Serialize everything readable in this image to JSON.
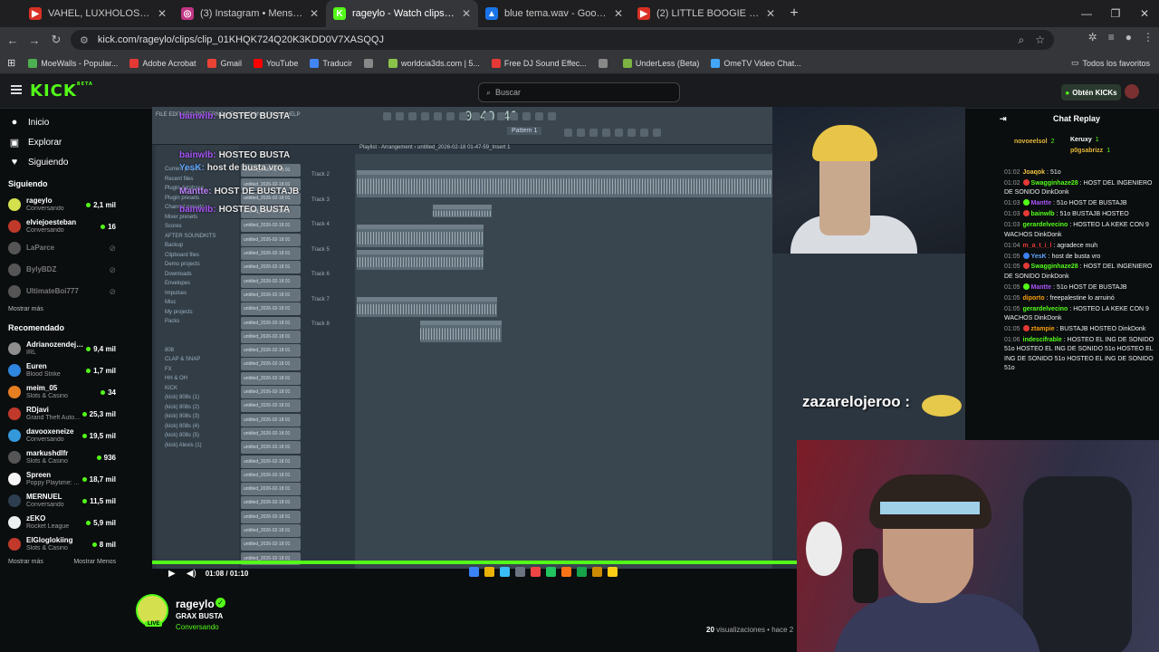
{
  "browser": {
    "tabs": [
      {
        "title": "VAHEL, LUXHOLOSNO, LOLO -",
        "fav_color": "#d93025",
        "fav": "▶"
      },
      {
        "title": "(3) Instagram • Mensajes",
        "fav_color": "#c13584",
        "fav": "◎"
      },
      {
        "title": "rageylo - Watch clips on Kick",
        "fav_color": "#53fc18",
        "fav": "K",
        "active": true
      },
      {
        "title": "blue tema.wav - Google Drive",
        "fav_color": "#1a73e8",
        "fav": "▲"
      },
      {
        "title": "(2) LITTLE BOOGIE - PUTISHOR",
        "fav_color": "#d93025",
        "fav": "▶"
      }
    ],
    "url": "kick.com/rageylo/clips/clip_01KHQK724Q20K3KDD0V7XASQQJ",
    "bookmarks": [
      {
        "label": "MoeWalls - Popular...",
        "color": "#4caf50"
      },
      {
        "label": "Adobe Acrobat",
        "color": "#e53935"
      },
      {
        "label": "Gmail",
        "color": "#ea4335"
      },
      {
        "label": "YouTube",
        "color": "#ff0000"
      },
      {
        "label": "Traducir",
        "color": "#4285f4"
      },
      {
        "label": "",
        "color": "#888888"
      },
      {
        "label": "worldcia3ds.com | 5...",
        "color": "#8bc34a"
      },
      {
        "label": "Free DJ Sound Effec...",
        "color": "#e53935"
      },
      {
        "label": "",
        "color": "#888888"
      },
      {
        "label": "UnderLess (Beta)",
        "color": "#7cb342"
      },
      {
        "label": "OmeTV Video Chat...",
        "color": "#42a5f5"
      }
    ],
    "all_bookmarks": "Todos los favoritos"
  },
  "kick": {
    "logo": "KICK",
    "logo_beta": "BETA",
    "search_placeholder": "Buscar",
    "get_kicks": "Obtén KICKs",
    "nav": [
      {
        "label": "Inicio",
        "icon": "●"
      },
      {
        "label": "Explorar",
        "icon": "▣"
      },
      {
        "label": "Siguiendo",
        "icon": "♥"
      }
    ],
    "following_title": "Siguiendo",
    "following": [
      {
        "name": "rageylo",
        "cat": "Conversando",
        "viewers": "2,1 mil",
        "color": "#d5e04e"
      },
      {
        "name": "elviejoesteban",
        "cat": "Conversando",
        "viewers": "16",
        "color": "#c0392b"
      },
      {
        "name": "LaParce",
        "cat": "",
        "viewers": "",
        "color": "#555555",
        "offline": true
      },
      {
        "name": "BylyBDZ",
        "cat": "",
        "viewers": "",
        "color": "#555555",
        "offline": true
      },
      {
        "name": "UltimateBoi777",
        "cat": "",
        "viewers": "",
        "color": "#555555",
        "offline": true
      }
    ],
    "show_more": "Mostrar más",
    "recommended_title": "Recomendado",
    "recommended": [
      {
        "name": "Adrianozendeja...",
        "cat": "IRL",
        "viewers": "9,4 mil",
        "color": "#8e8e8e"
      },
      {
        "name": "Euren",
        "cat": "Blood Strike",
        "viewers": "1,7 mil",
        "color": "#2e86de"
      },
      {
        "name": "meim_05",
        "cat": "Slots & Casino",
        "viewers": "34",
        "color": "#e67e22"
      },
      {
        "name": "RDjavi",
        "cat": "Grand Theft Auto...",
        "viewers": "25,3 mil",
        "color": "#c0392b"
      },
      {
        "name": "davooxeneize",
        "cat": "Conversando",
        "viewers": "19,5 mil",
        "color": "#3498db"
      },
      {
        "name": "markushdlfr",
        "cat": "Slots & Casino",
        "viewers": "936",
        "color": "#555555"
      },
      {
        "name": "Spreen",
        "cat": "Poppy Playtime: ...",
        "viewers": "18,7 mil",
        "color": "#f5f5f5"
      },
      {
        "name": "MERNUEL",
        "cat": "Conversando",
        "viewers": "11,5 mil",
        "color": "#2c3e50"
      },
      {
        "name": "zEKO",
        "cat": "Rocket League",
        "viewers": "5,9 mil",
        "color": "#ecf0f1"
      },
      {
        "name": "ElGloglokiing",
        "cat": "Slots & Casino",
        "viewers": "8 mil",
        "color": "#c0392b"
      }
    ],
    "show_more2": "Mostrar más",
    "show_less": "Mostrar Menos"
  },
  "video": {
    "fl_menu": "FILE EDIT ADD PATTERNS VIEW OPTIONS TOOLS HELP",
    "fl_time": "0:40:41",
    "pattern": "Pattern 1",
    "playlist_title": "Playlist - Arrangement › untitled_2026-02-18 01-47-59_Insert 1",
    "browser_items": [
      "Current project",
      "Recent files",
      "Plugin database",
      "Plugin presets",
      "Channel presets",
      "Mixer presets",
      "Scores",
      "AFTER SOUNDKITS",
      "Backup",
      "Clipboard files",
      "Demo projects",
      "Downloads",
      "Envelopes",
      "Impulses",
      "Misc",
      "My projects",
      "Packs",
      "",
      "",
      "808",
      "CLAP & SNAP",
      "FX",
      "HH & OH",
      "KICK",
      "(kick) 808s (1)",
      "(kick) 808s (2)",
      "(kick) 808s (3)",
      "(kick) 808s (4)",
      "(kick) 808s (5)",
      "(kick) Alexis (1)"
    ],
    "channels": [
      "untitled_2026-02-18 01",
      "untitled_2026-02-18 01",
      "untitled_2026-02-18 01",
      "untitled_2026-02-18 01",
      "untitled_2026-02-18 01",
      "untitled_2026-02-18 01",
      "untitled_2026-02-18 01",
      "untitled_2026-02-18 01",
      "untitled_2026-02-18 01",
      "untitled_2026-02-18 01",
      "untitled_2026-02-18 01",
      "untitled_2026-02-18 01",
      "untitled_2026-02-18 01",
      "untitled_2026-02-18 01",
      "untitled_2026-02-18 01",
      "untitled_2026-02-18 01",
      "untitled_2026-02-18 01",
      "untitled_2026-02-18 01",
      "untitled_2026-02-18 01",
      "untitled_2026-02-18 01",
      "untitled_2026-02-18 01",
      "untitled_2026-02-18 01",
      "untitled_2026-02-18 01",
      "untitled_2026-02-18 01",
      "untitled_2026-02-18 01",
      "untitled_2026-02-18 01",
      "untitled_2026-02-18 01",
      "untitled_2026-02-18 01",
      "untitled_2026-02-18 01"
    ],
    "tracks": [
      "Track 2",
      "Track 3",
      "Track 4",
      "Track 5",
      "Track 6",
      "Track 7",
      "Track 8"
    ],
    "overlay_chat": [
      {
        "user": "bainwlb:",
        "msg": "HOSTEO BUSTA",
        "color": "#a855f7"
      },
      {
        "user": "YesK:",
        "msg": "host de busta vro",
        "color": "#60a5fa"
      },
      {
        "user": "bainwlb:",
        "msg": "HOSTEO BUSTA",
        "color": "#a855f7"
      },
      {
        "user": "Mantte:",
        "msg": "HOST DE BUSTAJB",
        "color": "#c084fc"
      },
      {
        "user": "bainwlb:",
        "msg": "HOSTEO BUSTA",
        "color": "#a855f7"
      }
    ],
    "caption": "zazarelojeroo :",
    "time": "01:08 / 01:10"
  },
  "channel": {
    "name": "rageylo",
    "title": "GRAX BUSTA",
    "category": "Conversando",
    "live": "LIVE",
    "views_count": "20",
    "views_text": "visualizaciones • hace 2"
  },
  "chat": {
    "title": "Chat Replay",
    "pinned": [
      {
        "user": "novoeelsol",
        "sub": "2",
        "color": "#e6b93a"
      },
      {
        "user": "Keruxy",
        "sub": "1",
        "color": "#fff"
      },
      {
        "user": "p0gsabrizz",
        "sub": "1",
        "color": "#e6b93a"
      }
    ],
    "messages": [
      {
        "time": "01:02",
        "user": "Joaqok",
        "text": "51o",
        "color": "#f5c542",
        "badge": ""
      },
      {
        "time": "01:02",
        "user": "Swagginhaze28",
        "text": "HOST DEL INGENIERO DE SONIDO DinkDonk",
        "color": "#53fc18",
        "badge": "#e53935"
      },
      {
        "time": "01:03",
        "user": "Mantte",
        "text": "51o HOST DE BUSTAJB",
        "color": "#a855f7",
        "badge": "#53fc18"
      },
      {
        "time": "01:03",
        "user": "bainwlb",
        "text": "51o BUSTAJB HOSTEO",
        "color": "#53fc18",
        "badge": "#e53935"
      },
      {
        "time": "01:03",
        "user": "gerardelvecino",
        "text": "HOSTEO LA KEKE CON 9 WACHOS DinkDonk",
        "color": "#53fc18",
        "badge": ""
      },
      {
        "time": "01:04",
        "user": "m_a_t_i_l",
        "text": "agradece muh",
        "color": "#e53935",
        "badge": ""
      },
      {
        "time": "01:05",
        "user": "YesK",
        "text": "host de busta vro",
        "color": "#60a5fa",
        "badge": "#3b82f6"
      },
      {
        "time": "01:05",
        "user": "Swagginhaze28",
        "text": "HOST DEL INGENIERO DE SONIDO DinkDonk",
        "color": "#53fc18",
        "badge": "#e53935"
      },
      {
        "time": "01:05",
        "user": "Mantte",
        "text": "51o HOST DE BUSTAJB",
        "color": "#a855f7",
        "badge": "#53fc18"
      },
      {
        "time": "01:05",
        "user": "diporto",
        "text": "freepalestine lo arruinó",
        "color": "#f59e0b",
        "badge": ""
      },
      {
        "time": "01:05",
        "user": "gerardelvecino",
        "text": "HOSTEO LA KEKE CON 9 WACHOS DinkDonk",
        "color": "#53fc18",
        "badge": ""
      },
      {
        "time": "01:05",
        "user": "ztampie",
        "text": "BUSTAJB HOSTEO DinkDonk",
        "color": "#f59e0b",
        "badge": "#e53935"
      },
      {
        "time": "01:06",
        "user": "indescifrable",
        "text": "HOSTEO EL ING DE SONIDO 51o HOSTEO EL ING DE SONIDO 51o HOSTEO EL ING DE SONIDO 51o HOSTEO EL ING DE SONIDO 51o",
        "color": "#53fc18",
        "badge": ""
      }
    ]
  }
}
